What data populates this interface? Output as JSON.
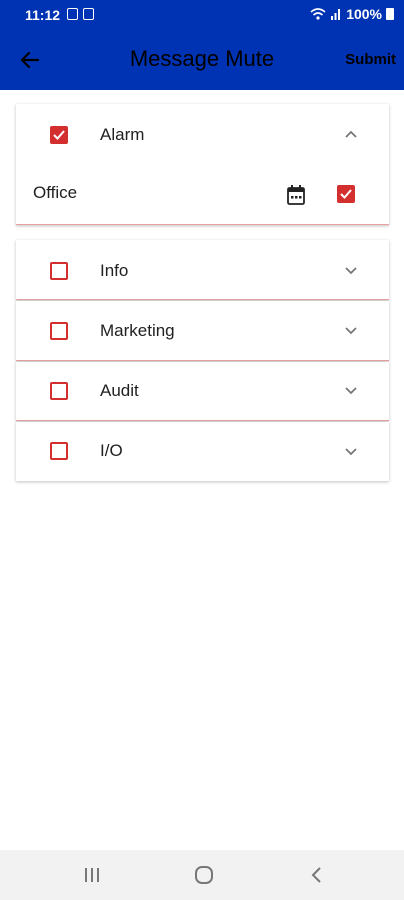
{
  "status_bar": {
    "time": "11:12",
    "battery": "100%"
  },
  "header": {
    "title": "Message Mute",
    "submit_label": "Submit",
    "background_color": "#0033b3"
  },
  "groups": [
    {
      "label": "Alarm",
      "checked": true,
      "expanded": true,
      "children": [
        {
          "label": "Office",
          "checked": true,
          "icon": "calendar-icon"
        }
      ]
    },
    {
      "label": "Info",
      "checked": false,
      "expanded": false
    },
    {
      "label": "Marketing",
      "checked": false,
      "expanded": false
    },
    {
      "label": "Audit",
      "checked": false,
      "expanded": false
    },
    {
      "label": "I/O",
      "checked": false,
      "expanded": false
    }
  ],
  "accent_color": "#d32f2f"
}
